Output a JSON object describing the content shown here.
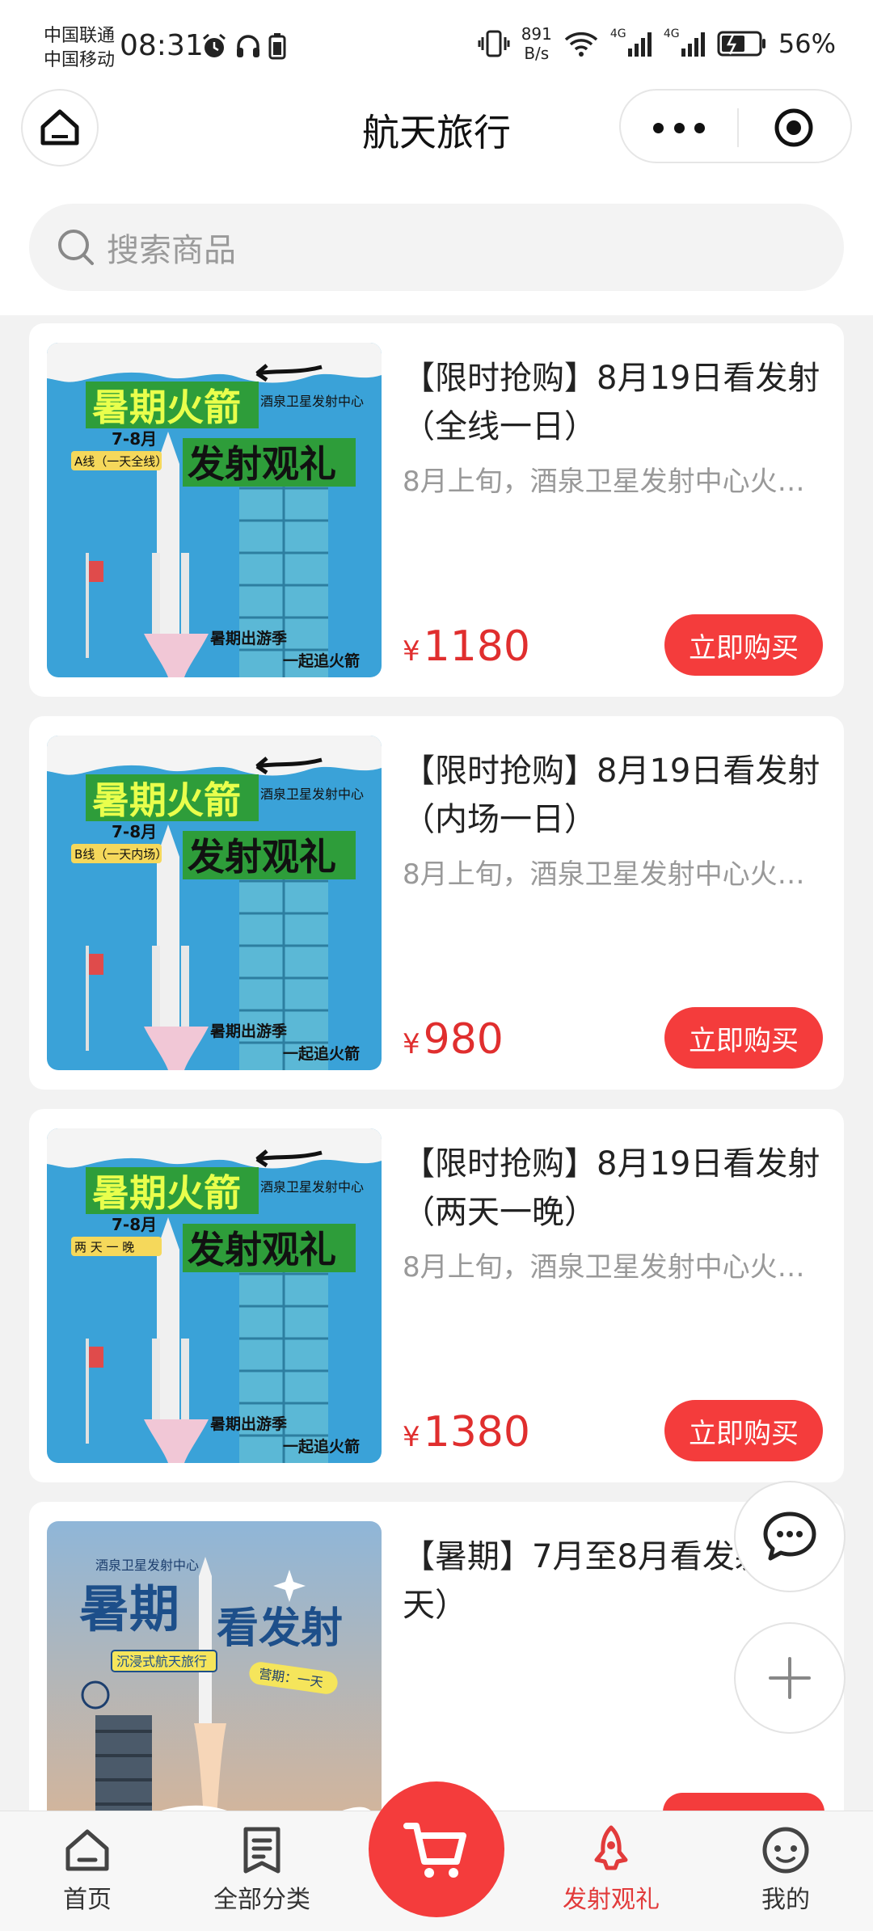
{
  "status_bar": {
    "carrier1": "中国联通",
    "carrier2": "中国移动",
    "time": "08:31",
    "net_speed_value": "891",
    "net_speed_unit": "B/s",
    "network_tag1": "4G",
    "network_tag2": "4G",
    "battery": "56%"
  },
  "nav": {
    "title": "航天旅行"
  },
  "search": {
    "placeholder": "搜索商品"
  },
  "products": [
    {
      "title": "【限时抢购】8月19日看发射（全线一日）",
      "desc": "8月上旬，酒泉卫星发射中心火…",
      "currency": "¥",
      "price": "1180",
      "button": "立即购买",
      "poster": {
        "headline1": "暑期火箭",
        "headline2": "发射观礼",
        "center": "酒泉卫星发射中心",
        "months": "7-8月",
        "tag": "A线（一天全线）",
        "footer1": "暑期出游季",
        "footer2": "一起追火箭"
      }
    },
    {
      "title": "【限时抢购】8月19日看发射（内场一日）",
      "desc": "8月上旬，酒泉卫星发射中心火…",
      "currency": "¥",
      "price": "980",
      "button": "立即购买",
      "poster": {
        "headline1": "暑期火箭",
        "headline2": "发射观礼",
        "center": "酒泉卫星发射中心",
        "months": "7-8月",
        "tag": "B线（一天内场）",
        "footer1": "暑期出游季",
        "footer2": "一起追火箭"
      }
    },
    {
      "title": "【限时抢购】8月19日看发射（两天一晚）",
      "desc": "8月上旬，酒泉卫星发射中心火…",
      "currency": "¥",
      "price": "1380",
      "button": "立即购买",
      "poster": {
        "headline1": "暑期火箭",
        "headline2": "发射观礼",
        "center": "酒泉卫星发射中心",
        "months": "7-8月",
        "tag": "两 天 一 晚",
        "footer1": "暑期出游季",
        "footer2": "一起追火箭"
      }
    },
    {
      "title": "【暑期】7月至8月看发射（1天）",
      "poster": {
        "center": "酒泉卫星发射中心",
        "headline1": "暑期",
        "headline2": "看发射",
        "ribbon": "沉浸式航天旅行",
        "tag": "营期：一天"
      }
    }
  ],
  "tabs": [
    {
      "label": "首页",
      "icon": "home-icon"
    },
    {
      "label": "全部分类",
      "icon": "category-list-icon"
    },
    {
      "label": "发射观礼",
      "icon": "launch-rocket-icon",
      "active": true
    },
    {
      "label": "我的",
      "icon": "profile-icon"
    }
  ],
  "colors": {
    "accent": "#f43c3c",
    "price": "#e02e2e",
    "active_tab": "#e23b3b"
  }
}
